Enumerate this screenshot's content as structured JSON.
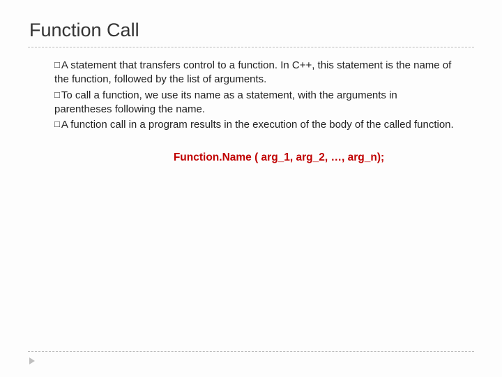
{
  "title": "Function Call",
  "bullets": [
    "A statement that transfers control to a function. In C++, this statement is the name of the function, followed by the list of arguments.",
    "To call a function, we use its name as a statement, with the arguments in parentheses following the name.",
    "A function call in a program results in the execution of the body of the called function."
  ],
  "syntax": "Function.Name ( arg_1, arg_2, …, arg_n);",
  "marker": "□"
}
